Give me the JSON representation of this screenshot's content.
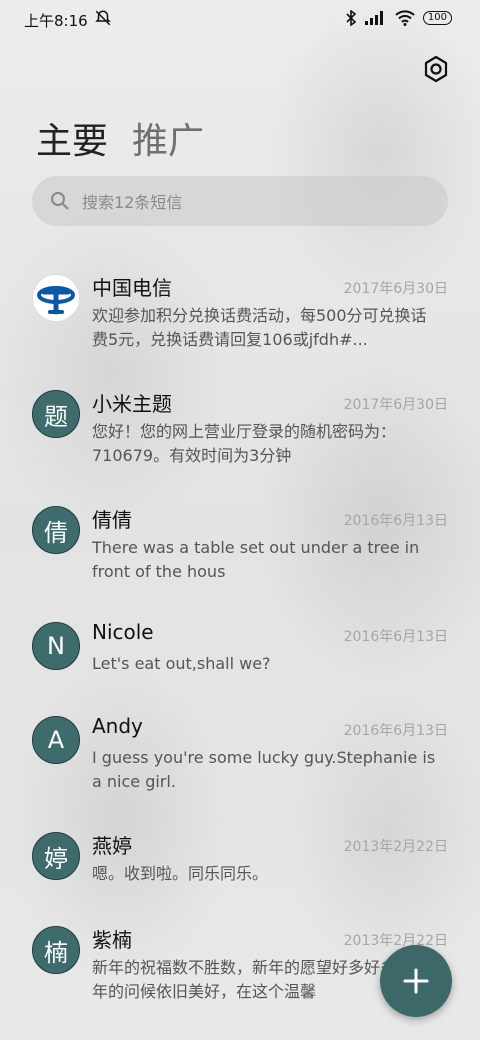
{
  "status_bar": {
    "time": "上午8:16",
    "battery": "100"
  },
  "tabs": {
    "main": "主要",
    "promo": "推广"
  },
  "search": {
    "placeholder": "搜索12条短信"
  },
  "messages": [
    {
      "sender": "中国电信",
      "date": "2017年6月30日",
      "preview": "欢迎参加积分兑换话费活动，每500分可兑换话费5元，兑换话费请回复106或jfdh#...",
      "avatar": ""
    },
    {
      "sender": "小米主题",
      "date": "2017年6月30日",
      "preview": "您好！您的网上营业厅登录的随机密码为：710679。有效时间为3分钟",
      "avatar": "题"
    },
    {
      "sender": "倩倩",
      "date": "2016年6月13日",
      "preview": "There was a table set out under a tree in front of the hous",
      "avatar": "倩"
    },
    {
      "sender": "Nicole",
      "date": "2016年6月13日",
      "preview": "Let's eat out,shall we?",
      "avatar": "N"
    },
    {
      "sender": "Andy",
      "date": "2016年6月13日",
      "preview": "I guess you're some lucky guy.Stephanie is a nice girl.",
      "avatar": "A"
    },
    {
      "sender": "燕婷",
      "date": "2013年2月22日",
      "preview": "嗯。收到啦。同乐同乐。",
      "avatar": "婷"
    },
    {
      "sender": "紫楠",
      "date": "2013年2月22日",
      "preview": "新年的祝福数不胜数，新年的愿望好多好多，新年的问候依旧美好，在这个温馨",
      "avatar": "楠"
    }
  ],
  "colors": {
    "accent": "#3e6b6c",
    "telecom_blue": "#0a57a8"
  }
}
